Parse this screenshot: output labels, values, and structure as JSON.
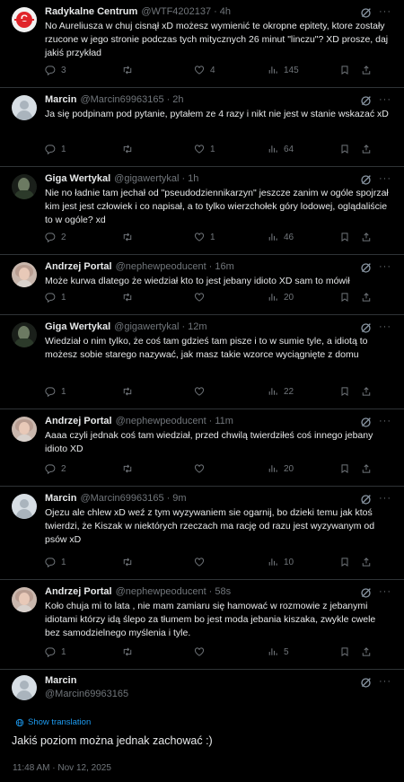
{
  "tweets": [
    {
      "name": "Radykalne Centrum",
      "handle": "@WTF4202137",
      "time": "4h",
      "text": "No Aureliusza w chuj cisnął xD możesz wymienić te okropne epitety, ktore zostały rzucone w jego stronie podczas tych mitycznych 26 minut \"linczu\"? XD prosze, daj jakiś przykład",
      "replies": "3",
      "reposts": "",
      "likes": "4",
      "views": "145",
      "avatar": "radykalne"
    },
    {
      "name": "Marcin",
      "handle": "@Marcin69963165",
      "time": "2h",
      "text": "Ja się podpinam pod pytanie, pytałem ze 4 razy i nikt nie jest w stanie wskazać xD",
      "replies": "1",
      "reposts": "",
      "likes": "1",
      "views": "64",
      "avatar": "marcin"
    },
    {
      "name": "Giga Wertykal",
      "handle": "@gigawertykal",
      "time": "1h",
      "text": "Nie no ładnie tam jechał od \"pseudodziennikarzyn\" jeszcze zanim w ogóle spojrzał kim jest jest człowiek i co napisał, a to tylko wierzchołek góry lodowej, oglądaliście to w ogóle? xd",
      "replies": "2",
      "reposts": "",
      "likes": "1",
      "views": "46",
      "avatar": "giga"
    },
    {
      "name": "Andrzej Portal",
      "handle": "@nephewpeoducent",
      "time": "16m",
      "text": "Może kurwa dlatego że wiedział kto to jest jebany idioto XD sam to mówił",
      "replies": "1",
      "reposts": "",
      "likes": "",
      "views": "20",
      "avatar": "andrzej"
    },
    {
      "name": "Giga Wertykal",
      "handle": "@gigawertykal",
      "time": "12m",
      "text": "Wiedział o nim tylko, że coś tam gdzieś tam pisze i to w sumie tyle, a idiotą to możesz sobie starego nazywać, jak masz takie wzorce wyciągnięte z domu",
      "replies": "1",
      "reposts": "",
      "likes": "",
      "views": "22",
      "avatar": "giga"
    },
    {
      "name": "Andrzej Portal",
      "handle": "@nephewpeoducent",
      "time": "11m",
      "text": "Aaaa czyli jednak coś tam wiedział, przed chwilą twierdziłeś coś innego jebany idioto XD",
      "replies": "2",
      "reposts": "",
      "likes": "",
      "views": "20",
      "avatar": "andrzej"
    },
    {
      "name": "Marcin",
      "handle": "@Marcin69963165",
      "time": "9m",
      "text": "Ojezu ale chlew xD weź z tym wyzywaniem sie ogarnij, bo dzieki temu jak ktoś twierdzi, że Kiszak w niektórych rzeczach ma rację od razu jest wyzywanym od psów xD",
      "replies": "1",
      "reposts": "",
      "likes": "",
      "views": "10",
      "avatar": "marcin"
    },
    {
      "name": "Andrzej Portal",
      "handle": "@nephewpeoducent",
      "time": "58s",
      "text": "Koło chuja mi to lata , nie mam zamiaru się hamować w rozmowie z jebanymi idiotami którzy idą ślepo za tłumem bo jest moda jebania kiszaka, zwykle cwele bez samodzielnego myślenia i tyle.",
      "replies": "1",
      "reposts": "",
      "likes": "",
      "views": "5",
      "avatar": "andrzej"
    }
  ],
  "focus": {
    "name": "Marcin",
    "handle": "@Marcin69963165",
    "translate": "Show translation",
    "text": "Jakiś poziom można jednak zachować :)",
    "timestamp": "11:48 AM · Nov 12, 2025"
  },
  "ui": {
    "more": "···",
    "dot": "·"
  },
  "colors": {
    "background": "#000000",
    "text": "#e7e9ea",
    "muted": "#71767b",
    "link": "#1d9bf0",
    "divider": "#2f3336"
  }
}
